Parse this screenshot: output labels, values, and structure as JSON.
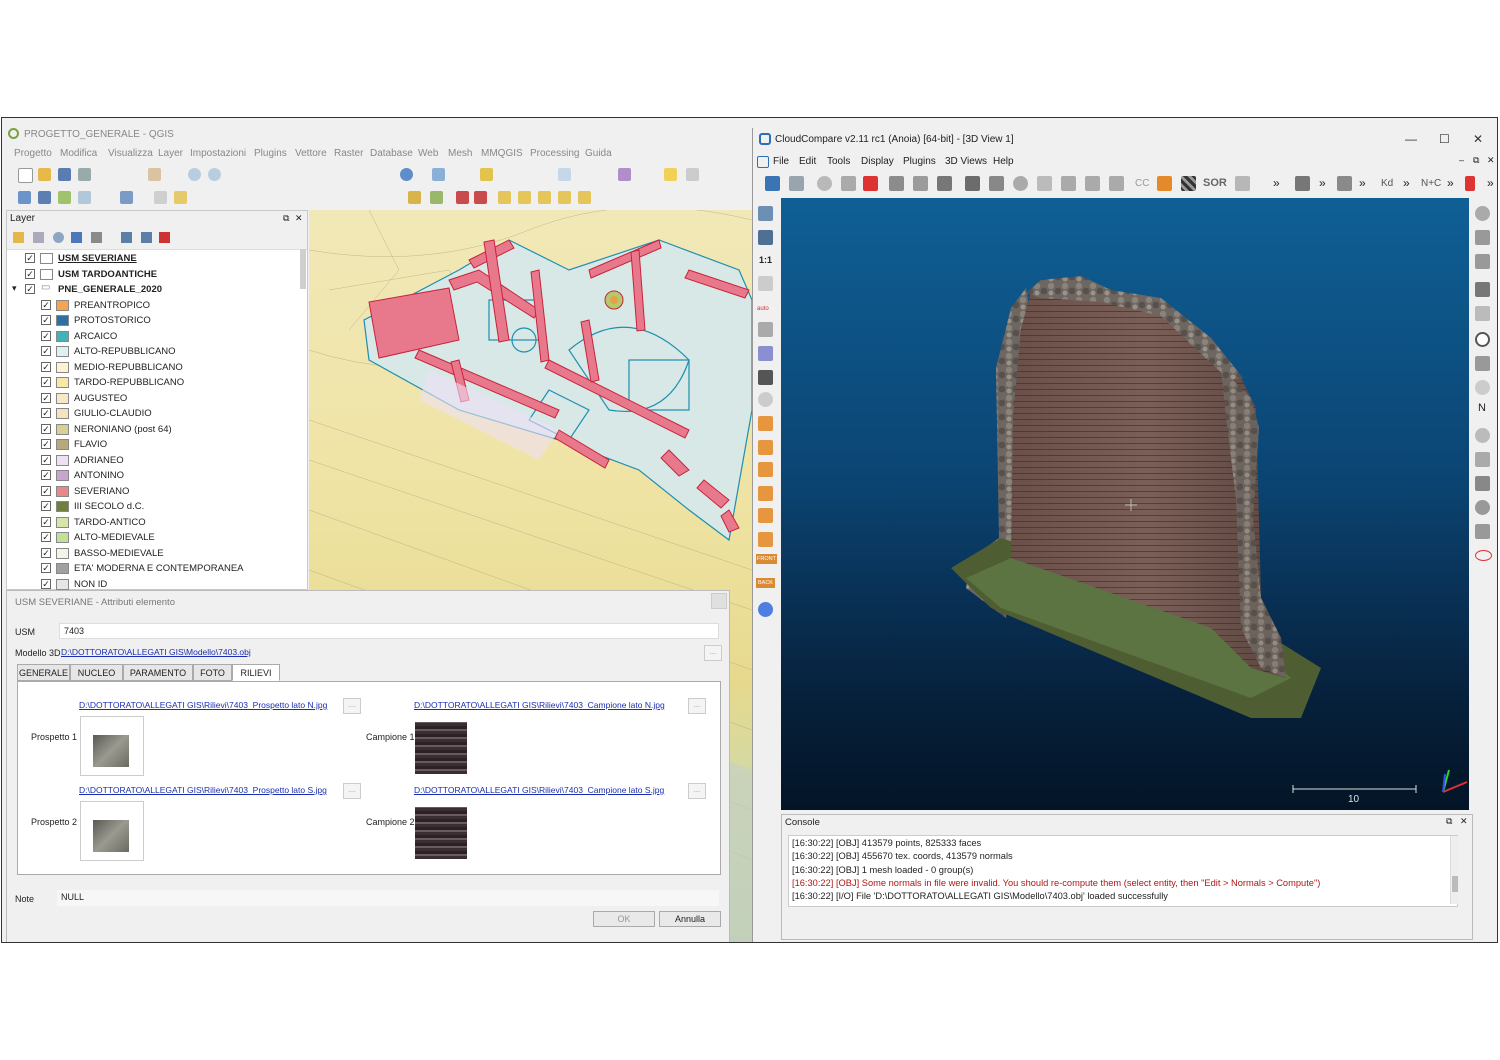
{
  "qgis": {
    "title": "PROGETTO_GENERALE - QGIS",
    "menu": [
      "Progetto",
      "Modifica",
      "Visualizza",
      "Layer",
      "Impostazioni",
      "Plugins",
      "Vettore",
      "Raster",
      "Database",
      "Web",
      "Mesh",
      "MMQGIS",
      "Processing",
      "Guida"
    ],
    "layer_panel": {
      "title": "Layer",
      "layers": [
        {
          "name": "USM SEVERIANE",
          "checked": true,
          "color": "#ffffff",
          "bold": true,
          "underline": true,
          "indent": 0
        },
        {
          "name": "USM TARDOANTICHE",
          "checked": true,
          "color": "#ffffff",
          "bold": true,
          "indent": 0
        },
        {
          "name": "PNE_GENERALE_2020",
          "checked": true,
          "color": "",
          "bold": true,
          "indent": 0,
          "expanded": true
        },
        {
          "name": "PREANTROPICO",
          "checked": true,
          "color": "#f7a451",
          "indent": 1
        },
        {
          "name": "PROTOSTORICO",
          "checked": true,
          "color": "#2f6f9f",
          "indent": 1
        },
        {
          "name": "ARCAICO",
          "checked": true,
          "color": "#3fb3b8",
          "indent": 1
        },
        {
          "name": "ALTO-REPUBBLICANO",
          "checked": true,
          "color": "#dff0f2",
          "indent": 1
        },
        {
          "name": "MEDIO-REPUBBLICANO",
          "checked": true,
          "color": "#fbf4d4",
          "indent": 1
        },
        {
          "name": "TARDO-REPUBBLICANO",
          "checked": true,
          "color": "#f9e7a5",
          "indent": 1
        },
        {
          "name": "AUGUSTEO",
          "checked": true,
          "color": "#f7e8c8",
          "indent": 1
        },
        {
          "name": "GIULIO-CLAUDIO",
          "checked": true,
          "color": "#f4e3bd",
          "indent": 1
        },
        {
          "name": "NERONIANO (post 64)",
          "checked": true,
          "color": "#d8cf93",
          "indent": 1
        },
        {
          "name": "FLAVIO",
          "checked": true,
          "color": "#b9a97a",
          "indent": 1
        },
        {
          "name": "ADRIANEO",
          "checked": true,
          "color": "#efe0f5",
          "indent": 1
        },
        {
          "name": "ANTONINO",
          "checked": true,
          "color": "#c7a5cf",
          "indent": 1
        },
        {
          "name": "SEVERIANO",
          "checked": true,
          "color": "#e8888a",
          "indent": 1
        },
        {
          "name": "III SECOLO d.C.",
          "checked": true,
          "color": "#6f7f3e",
          "indent": 1
        },
        {
          "name": "TARDO-ANTICO",
          "checked": true,
          "color": "#d6e6a8",
          "indent": 1
        },
        {
          "name": "ALTO-MEDIEVALE",
          "checked": true,
          "color": "#c3df98",
          "indent": 1
        },
        {
          "name": "BASSO-MEDIEVALE",
          "checked": true,
          "color": "#f3f3e6",
          "indent": 1
        },
        {
          "name": "ETA' MODERNA E CONTEMPORANEA",
          "checked": true,
          "color": "#a0a0a0",
          "indent": 1
        },
        {
          "name": "NON ID",
          "checked": true,
          "color": "#e6e6e6",
          "indent": 1
        }
      ]
    }
  },
  "attr_dialog": {
    "title": "USM SEVERIANE - Attributi elemento",
    "usm_label": "USM",
    "usm_value": "7403",
    "model_label": "Modello 3D",
    "model_path": "D:\\DOTTORATO\\ALLEGATI GIS\\Modello\\7403.obj",
    "tabs": [
      "GENERALE",
      "NUCLEO",
      "PARAMENTO",
      "FOTO",
      "RILIEVI"
    ],
    "active_tab": "RILIEVI",
    "entries": [
      {
        "label": "Prospetto 1",
        "path": "D:\\DOTTORATO\\ALLEGATI GIS\\Rilievi\\7403_Prospetto lato N.jpg"
      },
      {
        "label": "Campione 1",
        "path": "D:\\DOTTORATO\\ALLEGATI GIS\\Rilievi\\7403_Campione lato N.jpg"
      },
      {
        "label": "Prospetto 2",
        "path": "D:\\DOTTORATO\\ALLEGATI GIS\\Rilievi\\7403_Prospetto lato S.jpg"
      },
      {
        "label": "Campione 2",
        "path": "D:\\DOTTORATO\\ALLEGATI GIS\\Rilievi\\7403_Campione lato S.jpg"
      }
    ],
    "browse_label": "...",
    "note_label": "Note",
    "note_value": "NULL",
    "ok_label": "OK",
    "cancel_label": "Annulla"
  },
  "cloudcompare": {
    "title": "CloudCompare v2.11 rc1 (Anoia) [64-bit] - [3D View 1]",
    "menu": [
      "File",
      "Edit",
      "Tools",
      "Display",
      "Plugins",
      "3D Views",
      "Help"
    ],
    "toolbar_text": {
      "sor": "SOR",
      "cc": "CC",
      "nc": "N+C",
      "kd": "Kd",
      "overflow": "»"
    },
    "left_text": {
      "one_to_one": "1:1",
      "auto": "auto",
      "front": "FRONT",
      "back": "BACK"
    },
    "scale_label": "10",
    "console": {
      "title": "Console",
      "lines": [
        {
          "text": "[16:30:22] [OBJ] 413579 points, 825333 faces",
          "warn": false
        },
        {
          "text": "[16:30:22] [OBJ] 455670 tex. coords, 413579 normals",
          "warn": false
        },
        {
          "text": "[16:30:22] [OBJ] 1 mesh loaded - 0 group(s)",
          "warn": false
        },
        {
          "text": "[16:30:22] [OBJ] Some normals in file were invalid. You should re-compute them (select entity, then \"Edit > Normals > Compute\")",
          "warn": true
        },
        {
          "text": "[16:30:22] [I/O] File 'D:\\DOTTORATO\\ALLEGATI GIS\\Modello\\7403.obj' loaded successfully",
          "warn": false
        }
      ]
    }
  }
}
